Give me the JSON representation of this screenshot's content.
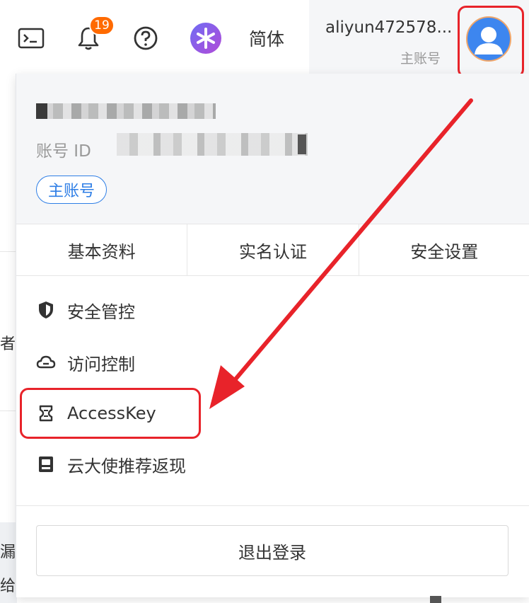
{
  "topbar": {
    "notification_count": "19",
    "language": "简体",
    "account_name": "aliyun472578...",
    "account_type": "主账号",
    "icons": [
      "terminal-icon",
      "bell-icon",
      "help-icon",
      "spark-logo-icon",
      "avatar-icon"
    ]
  },
  "background": {
    "fragment_1": "者",
    "fragment_2": "漏",
    "fragment_3": "给"
  },
  "panel": {
    "account_id_label": "账号 ID",
    "role_tag": "主账号",
    "tabs": [
      {
        "label": "基本资料"
      },
      {
        "label": "实名认证"
      },
      {
        "label": "安全设置"
      }
    ],
    "menu": [
      {
        "label": "安全管控",
        "icon": "shield-icon"
      },
      {
        "label": "访问控制",
        "icon": "cloud-icon"
      },
      {
        "label": "AccessKey",
        "icon": "key-icon"
      },
      {
        "label": "云大使推荐返现",
        "icon": "card-icon"
      }
    ],
    "logout_label": "退出登录"
  },
  "colors": {
    "accent_blue": "#2e7ee6",
    "badge_orange": "#ff6a00",
    "annotation_red": "#e8232a",
    "avatar_blue": "#3d86ef",
    "header_bg": "#f5f6f8"
  }
}
